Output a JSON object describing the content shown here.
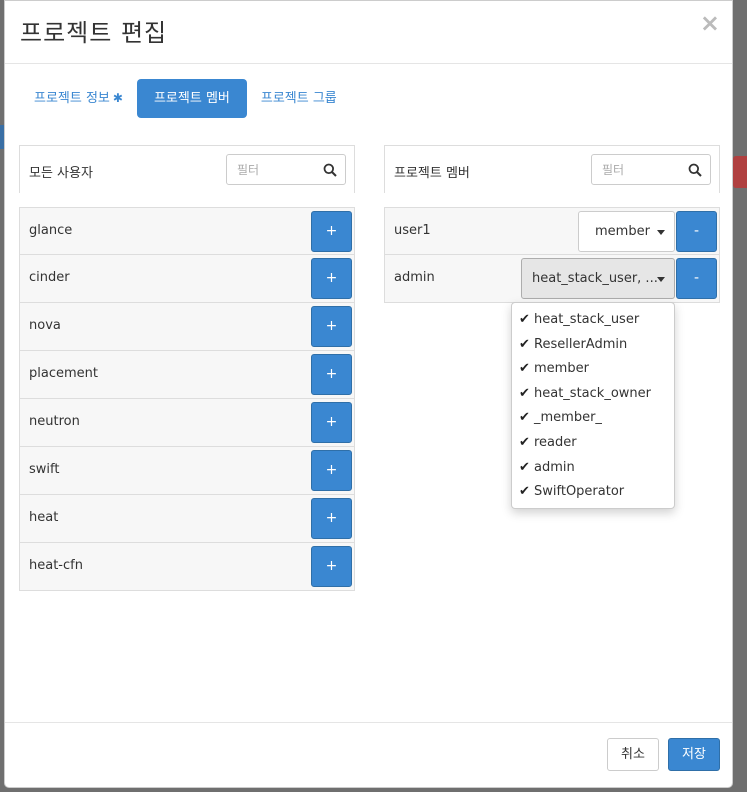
{
  "title": "프로젝트 편집",
  "close_symbol": "×",
  "tabs": [
    {
      "label": "프로젝트 정보",
      "required_mark": "✱",
      "active": false
    },
    {
      "label": "프로젝트 멤버",
      "active": true
    },
    {
      "label": "프로젝트 그룹",
      "active": false
    }
  ],
  "all_users": {
    "label": "모든 사용자",
    "filter_placeholder": "필터",
    "add_label": "+",
    "users": [
      "glance",
      "cinder",
      "nova",
      "placement",
      "neutron",
      "swift",
      "heat",
      "heat-cfn"
    ]
  },
  "project_members": {
    "label": "프로젝트 멤버",
    "filter_placeholder": "필터",
    "remove_label": "-",
    "members": [
      {
        "name": "user1",
        "roles_display": "member"
      },
      {
        "name": "admin",
        "roles_display": "heat_stack_user, ..."
      }
    ]
  },
  "role_dropdown": {
    "check_icon": "check-icon",
    "options": [
      "heat_stack_user",
      "ResellerAdmin",
      "member",
      "heat_stack_owner",
      "_member_",
      "reader",
      "admin",
      "SwiftOperator"
    ]
  },
  "footer": {
    "cancel_label": "취소",
    "save_label": "저장"
  },
  "colors": {
    "primary": "#3a87d1",
    "backdrop": "#6f6f6f"
  }
}
